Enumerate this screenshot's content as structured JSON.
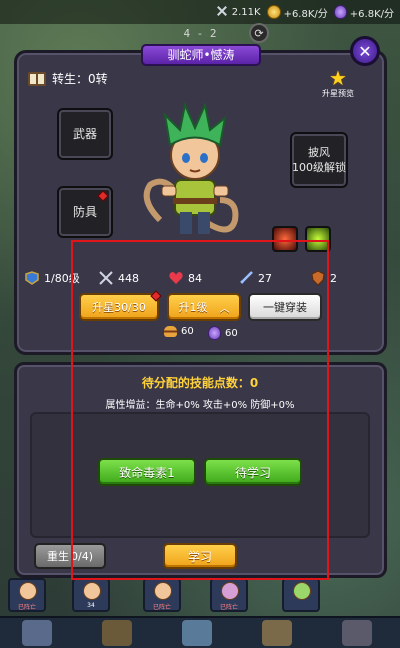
{
  "resources": {
    "res1_value": "2.11K",
    "res2_value": "+6.8K/分",
    "res3_value": "+6.8K/分"
  },
  "stage": "4 - 2",
  "title": "驯蛇师•憾涛",
  "rebirth": {
    "label": "转生：",
    "value": "0转"
  },
  "star_preview_label": "升星预览",
  "equipment": {
    "weapon": "武器",
    "armor": "防具",
    "cloak_line1": "披风",
    "cloak_line2": "100级解锁"
  },
  "stats": {
    "level": "1/80级",
    "attack_power": "448",
    "hp": "84",
    "attack": "27",
    "defense": "2"
  },
  "buttons": {
    "star_up": "升星30/30",
    "level_up": "升1级",
    "one_key_equip": "一键穿装",
    "skill_deadly_poison": "致命毒素1",
    "skill_pending": "待学习",
    "reset": "重生",
    "reset_count": "0/4)",
    "learn": "学习"
  },
  "costs": {
    "burger": "60",
    "potion": "60"
  },
  "skill_panel": {
    "points_label": "待分配的技能点数：",
    "points_value": "0",
    "attrs": "属性增益：生命+0% 攻击+0% 防御+0%"
  },
  "hero_strip": [
    {
      "label": "已阵亡"
    },
    {
      "label": "34"
    },
    {
      "label": "已阵亡"
    },
    {
      "label": "已阵亡"
    },
    {
      "label": ""
    }
  ],
  "colors": {
    "panel": "#3a3749",
    "title_tab": "#6a32c0",
    "orange_btn": "#f6b02a",
    "green_btn": "#4fbf24",
    "highlight": "#e0151a"
  },
  "icons": {
    "rebirth": "book-icon",
    "preview": "star-icon",
    "level": "level-badge-icon",
    "attack_power": "crossed-swords-icon",
    "hp": "heart-icon",
    "attack": "sword-icon",
    "defense": "shield-icon"
  }
}
